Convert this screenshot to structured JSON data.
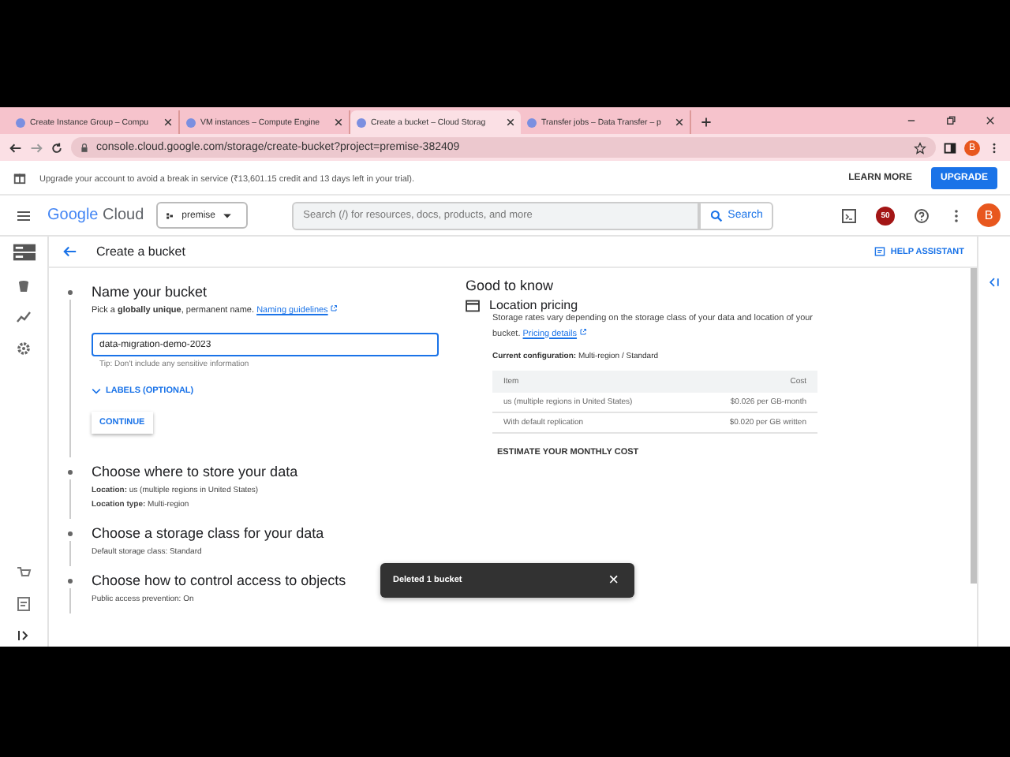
{
  "tabs": [
    {
      "title": "Create Instance Group – Compu",
      "selected": false
    },
    {
      "title": "VM instances – Compute Engine",
      "selected": false
    },
    {
      "title": "Create a bucket – Cloud Storag",
      "selected": true
    },
    {
      "title": "Transfer jobs – Data Transfer – p",
      "selected": false
    }
  ],
  "address": "console.cloud.google.com/storage/create-bucket?project=premise-382409",
  "profile": "B",
  "banner": {
    "text": "Upgrade your account to avoid a break in service (₹13,601.15 credit and 13 days left in your trial).",
    "learn_more": "LEARN MORE",
    "upgrade": "UPGRADE"
  },
  "header": {
    "logo_first": "Google",
    "logo_second": "Cloud",
    "project": "premise",
    "search_placeholder": "Search (/) for resources, docs, products, and more",
    "search_button": "Search",
    "notifications": "50",
    "avatar": "B"
  },
  "page": {
    "title": "Create a bucket",
    "help": "HELP ASSISTANT"
  },
  "steps": [
    {
      "kind": "active",
      "title": "Name your bucket",
      "description": "Pick a **globally unique**, permanent name.",
      "link": "Naming guidelines",
      "value": "data-migration-demo-2023",
      "tip": "Tip: Don't include any sensitive information",
      "labels": "LABELS (OPTIONAL)",
      "continue": "CONTINUE"
    },
    {
      "kind": "summary",
      "title": "Choose where to store your data",
      "lines": [
        "**Location:** us (multiple regions in United States)",
        "**Location type:** Multi-region"
      ]
    },
    {
      "kind": "summary",
      "title": "Choose a storage class for your data",
      "lines": [
        "Default storage class: Standard"
      ]
    },
    {
      "kind": "summary",
      "title": "Choose how to control access to objects",
      "lines": [
        "Public access prevention: On"
      ]
    }
  ],
  "info": {
    "heading": "Good to know",
    "title": "Location pricing",
    "text": "Storage rates vary depending on the storage class of your data and location of your bucket.",
    "link": "Pricing details",
    "config": "**Current configuration:** Multi-region / Standard",
    "columns": [
      "Item",
      "Cost"
    ],
    "rows": [
      [
        "us (multiple regions in United States)",
        "$0.026 per GB-month"
      ],
      [
        "With default replication",
        "$0.020 per GB written"
      ]
    ],
    "estimate": "ESTIMATE YOUR MONTHLY COST"
  },
  "toast": {
    "text": "Deleted 1 bucket",
    "close": "×"
  }
}
